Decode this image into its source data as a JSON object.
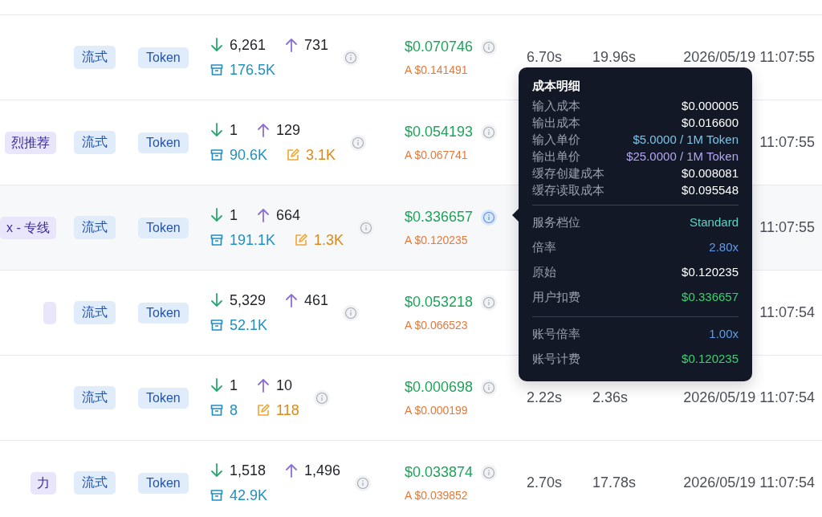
{
  "rows": [
    {
      "highlighted": false,
      "model_tag": false,
      "stream_tag": "流式",
      "type_tag": "Token",
      "input": "6,261",
      "output": "731",
      "cache_read": "176.5K",
      "cost": "$0.070746",
      "actual": "A $0.141491",
      "cost_info_active": false,
      "first_token": "6.70s",
      "total": "19.96s",
      "time": "2026/05/19 11:07:55"
    },
    {
      "highlighted": false,
      "model_tag": true,
      "model_tag_text": "烈推荐",
      "stream_tag": "流式",
      "type_tag": "Token",
      "input": "1",
      "output": "129",
      "cache_read": "90.6K",
      "cache_write": "3.1K",
      "cost": "$0.054193",
      "actual": "A $0.067741",
      "cost_info_active": false,
      "time": "11:07:55"
    },
    {
      "highlighted": true,
      "model_tag": true,
      "model_tag_text": "x - 专线",
      "stream_tag": "流式",
      "type_tag": "Token",
      "input": "1",
      "output": "664",
      "cache_read": "191.1K",
      "cache_write": "1.3K",
      "cost": "$0.336657",
      "actual": "A $0.120235",
      "cost_info_active": true,
      "time": "11:07:55"
    },
    {
      "highlighted": false,
      "model_tag": true,
      "stream_tag": "流式",
      "type_tag": "Token",
      "input": "5,329",
      "output": "461",
      "cache_read": "52.1K",
      "cost": "$0.053218",
      "actual": "A $0.066523",
      "cost_info_active": false,
      "time": "11:07:54"
    },
    {
      "highlighted": false,
      "model_tag": false,
      "stream_tag": "流式",
      "type_tag": "Token",
      "input": "1",
      "output": "10",
      "cache_read": "8",
      "cache_write": "118",
      "cost": "$0.000698",
      "actual": "A $0.000199",
      "cost_info_active": false,
      "first_token": "2.22s",
      "total": "2.36s",
      "time": "2026/05/19 11:07:54"
    },
    {
      "highlighted": false,
      "model_tag": true,
      "model_tag_text": "力",
      "stream_tag": "流式",
      "type_tag": "Token",
      "input": "1,518",
      "output": "1,496",
      "cache_read": "42.9K",
      "cost": "$0.033874",
      "actual": "A $0.039852",
      "cost_info_active": false,
      "first_token": "2.70s",
      "total": "17.78s",
      "time": "2026/05/19 11:07:54"
    }
  ],
  "tooltip": {
    "title": "成本明细",
    "sections": [
      {
        "kind": "compact",
        "items": [
          {
            "label": "输入成本",
            "value": "$0.000005",
            "color": "#ffffff"
          },
          {
            "label": "输出成本",
            "value": "$0.016600",
            "color": "#ffffff"
          },
          {
            "label": "输入单价",
            "value": "$5.0000 / 1M Token",
            "color": "#7cc4e8"
          },
          {
            "label": "输出单价",
            "value": "$25.0000 / 1M Token",
            "color": "#b4a7f0"
          },
          {
            "label": "缓存创建成本",
            "value": "$0.008081",
            "color": "#ffffff"
          },
          {
            "label": "缓存读取成本",
            "value": "$0.095548",
            "color": "#ffffff"
          }
        ]
      },
      {
        "kind": "spaced",
        "items": [
          {
            "label": "服务档位",
            "value": "Standard",
            "color": "#5fd3c4"
          },
          {
            "label": "倍率",
            "value": "2.80x",
            "color": "#5b9cf0"
          },
          {
            "label": "原始",
            "value": "$0.120235",
            "color": "#ffffff"
          },
          {
            "label": "用户扣费",
            "value": "$0.336657",
            "color": "#3fcf72"
          }
        ]
      },
      {
        "kind": "spaced",
        "items": [
          {
            "label": "账号倍率",
            "value": "1.00x",
            "color": "#5b9cf0"
          },
          {
            "label": "账号计费",
            "value": "$0.120235",
            "color": "#3fcf72"
          }
        ]
      }
    ]
  }
}
